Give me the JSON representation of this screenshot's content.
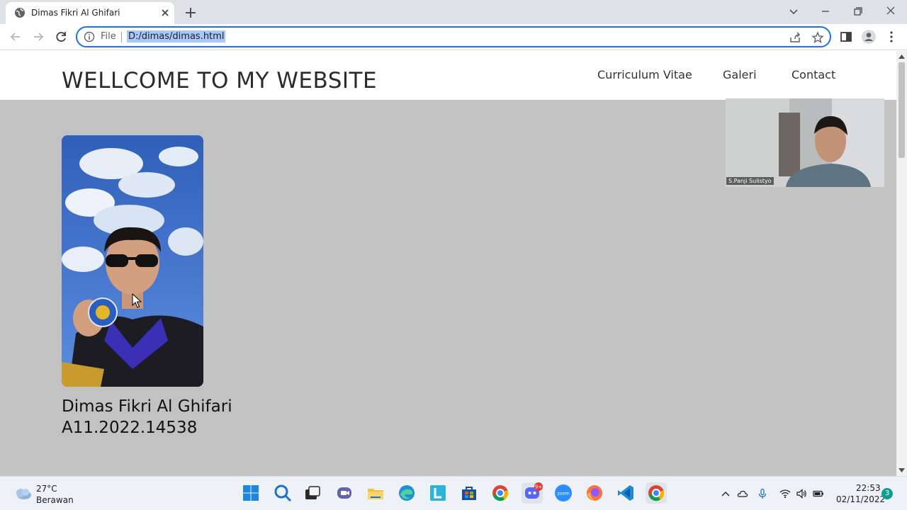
{
  "browser": {
    "tab_title": "Dimas Fikri Al Ghifari",
    "scheme_label": "File",
    "url": "D:/dimas/dimas.html"
  },
  "page": {
    "site_title": "WELLCOME TO MY WEBSITE",
    "nav": [
      {
        "label": "Curriculum Vitae"
      },
      {
        "label": "Galeri"
      },
      {
        "label": "Contact"
      }
    ],
    "person_name": "Dimas Fikri Al Ghifari",
    "person_id": "A11.2022.14538",
    "webcam_name": "S.Panji Sulistyo"
  },
  "taskbar": {
    "weather_temp": "27°C",
    "weather_desc": "Berawan",
    "discord_badge": "9+",
    "zoom_label": "zoom",
    "clock_time": "22:53",
    "clock_date": "02/11/2022",
    "notification_count": "3"
  },
  "colors": {
    "accent": "#1a73e8",
    "page_background": "#c2c2c2",
    "tab_strip": "#dee1e6"
  }
}
